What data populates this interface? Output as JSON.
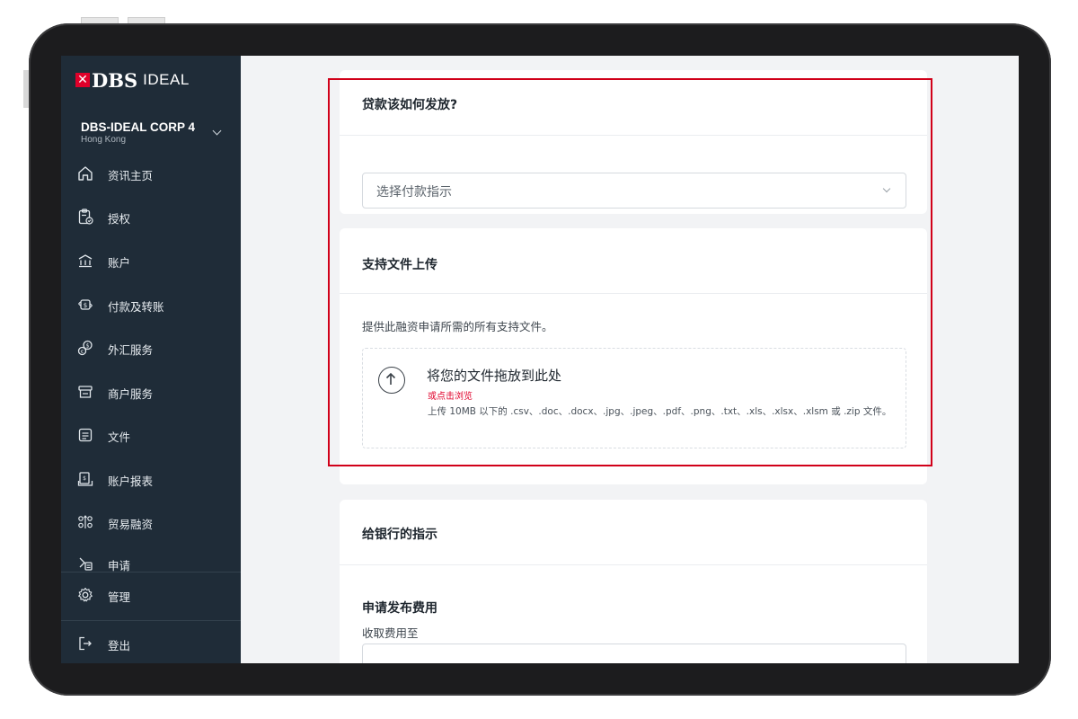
{
  "brand": {
    "logo_main": "DBS",
    "logo_sub": "IDEAL",
    "accent_color": "#e0002a",
    "sidebar_color": "#1f2c38"
  },
  "account": {
    "name": "DBS-IDEAL CORP 4",
    "location": "Hong Kong"
  },
  "nav": {
    "items": [
      {
        "label": "资讯主页",
        "icon": "home-icon"
      },
      {
        "label": "授权",
        "icon": "clipboard-check-icon"
      },
      {
        "label": "账户",
        "icon": "bank-icon"
      },
      {
        "label": "付款及转账",
        "icon": "transfer-icon"
      },
      {
        "label": "外汇服务",
        "icon": "fx-icon"
      },
      {
        "label": "商户服务",
        "icon": "merchant-icon"
      },
      {
        "label": "文件",
        "icon": "document-icon"
      },
      {
        "label": "账户报表",
        "icon": "report-icon"
      },
      {
        "label": "贸易融资",
        "icon": "trade-finance-icon"
      },
      {
        "label": "申请",
        "icon": "application-icon"
      }
    ],
    "manage": {
      "label": "管理",
      "icon": "gear-icon"
    },
    "logout": {
      "label": "登出",
      "icon": "logout-icon"
    }
  },
  "disbursement": {
    "title": "贷款该如何发放?",
    "select_placeholder": "选择付款指示"
  },
  "documents": {
    "title": "支持文件上传",
    "description": "提供此融资申请所需的所有支持文件。",
    "drop_title": "将您的文件拖放到此处",
    "browse_link": "或点击浏览",
    "hint": "上传 10MB 以下的 .csv、.doc、.docx、.jpg、.jpeg、.pdf、.png、.txt、.xls、.xlsx、.xlsm 或 .zip 文件。"
  },
  "instructions": {
    "title": "给银行的指示",
    "fee_title": "申请发布费用",
    "fee_label": "收取费用至"
  }
}
